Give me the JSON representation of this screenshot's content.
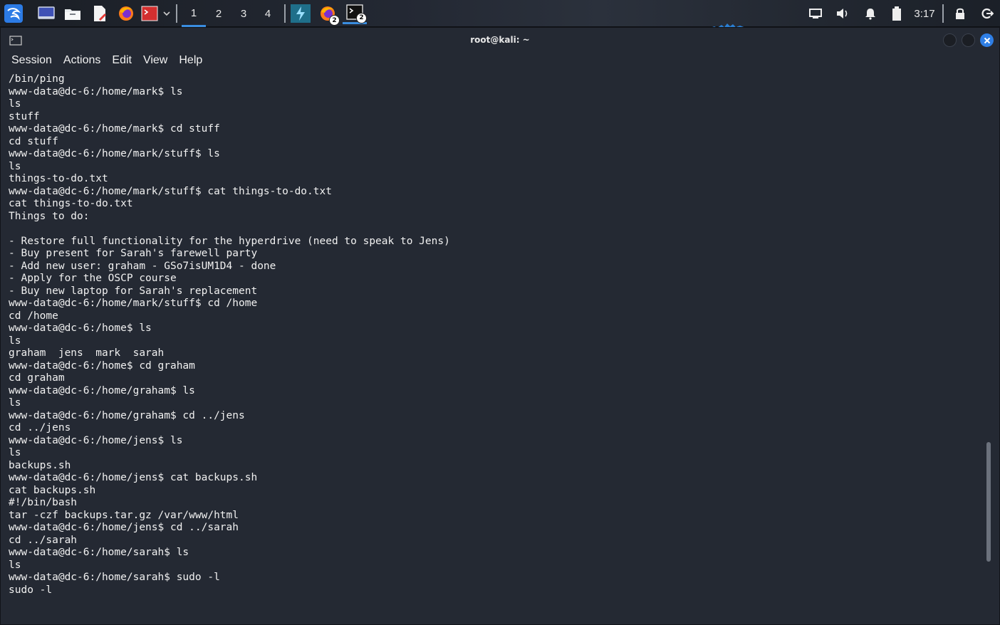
{
  "taskbar": {
    "workspaces": [
      "1",
      "2",
      "3",
      "4"
    ],
    "active_workspace": "1",
    "firefox_badge": "2",
    "terminal_badge": "2",
    "clock": "3:17",
    "icons": [
      "kali-menu-icon",
      "desktop-icon",
      "file-manager-icon",
      "text-editor-icon",
      "firefox-icon",
      "terminal-red-icon",
      "chevron-down-icon",
      "burp-icon",
      "firefox-window-icon",
      "terminal-window-icon",
      "display-icon",
      "volume-icon",
      "bell-icon",
      "battery-icon",
      "lock-icon",
      "logout-icon"
    ]
  },
  "window": {
    "title": "root@kali: ~"
  },
  "menu": {
    "items": [
      "Session",
      "Actions",
      "Edit",
      "View",
      "Help"
    ]
  },
  "terminal": {
    "lines": [
      "/bin/ping",
      "www-data@dc-6:/home/mark$ ls",
      "ls",
      "stuff",
      "www-data@dc-6:/home/mark$ cd stuff",
      "cd stuff",
      "www-data@dc-6:/home/mark/stuff$ ls",
      "ls",
      "things-to-do.txt",
      "www-data@dc-6:/home/mark/stuff$ cat things-to-do.txt",
      "cat things-to-do.txt",
      "Things to do:",
      "",
      "- Restore full functionality for the hyperdrive (need to speak to Jens)",
      "- Buy present for Sarah's farewell party",
      "- Add new user: graham - GSo7isUM1D4 - done",
      "- Apply for the OSCP course",
      "- Buy new laptop for Sarah's replacement",
      "www-data@dc-6:/home/mark/stuff$ cd /home",
      "cd /home",
      "www-data@dc-6:/home$ ls",
      "ls",
      "graham  jens  mark  sarah",
      "www-data@dc-6:/home$ cd graham",
      "cd graham",
      "www-data@dc-6:/home/graham$ ls",
      "ls",
      "www-data@dc-6:/home/graham$ cd ../jens",
      "cd ../jens",
      "www-data@dc-6:/home/jens$ ls",
      "ls",
      "backups.sh",
      "www-data@dc-6:/home/jens$ cat backups.sh",
      "cat backups.sh",
      "#!/bin/bash",
      "tar -czf backups.tar.gz /var/www/html",
      "www-data@dc-6:/home/jens$ cd ../sarah",
      "cd ../sarah",
      "www-data@dc-6:/home/sarah$ ls",
      "ls",
      "www-data@dc-6:/home/sarah$ sudo -l",
      "sudo -l"
    ]
  }
}
